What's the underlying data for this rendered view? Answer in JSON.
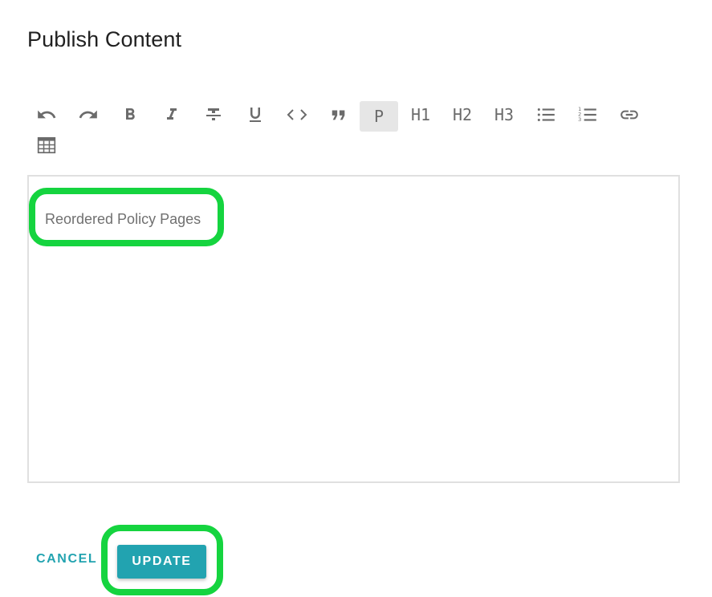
{
  "dialog": {
    "title": "Publish Content"
  },
  "toolbar": {
    "buttons": [
      {
        "name": "undo",
        "icon": "undo-icon"
      },
      {
        "name": "redo",
        "icon": "redo-icon"
      },
      {
        "name": "bold",
        "icon": "bold-icon"
      },
      {
        "name": "italic",
        "icon": "italic-icon"
      },
      {
        "name": "strikethrough",
        "icon": "strikethrough-icon"
      },
      {
        "name": "underline",
        "icon": "underline-icon"
      },
      {
        "name": "code",
        "icon": "code-icon"
      },
      {
        "name": "blockquote",
        "icon": "quote-icon"
      },
      {
        "name": "paragraph",
        "label": "P",
        "active": true
      },
      {
        "name": "heading-1",
        "label": "H1"
      },
      {
        "name": "heading-2",
        "label": "H2"
      },
      {
        "name": "heading-3",
        "label": "H3"
      },
      {
        "name": "bullet-list",
        "icon": "bullet-list-icon"
      },
      {
        "name": "numbered-list",
        "icon": "numbered-list-icon"
      },
      {
        "name": "link",
        "icon": "link-icon"
      },
      {
        "name": "table",
        "icon": "table-icon"
      }
    ]
  },
  "editor": {
    "content": "Reordered Policy Pages"
  },
  "actions": {
    "cancel_label": "CANCEL",
    "update_label": "UPDATE"
  },
  "colors": {
    "accent": "#22a3b0",
    "highlight": "#15d43f",
    "icon": "#6b6b6b",
    "active_bg": "#e6e6e6"
  }
}
